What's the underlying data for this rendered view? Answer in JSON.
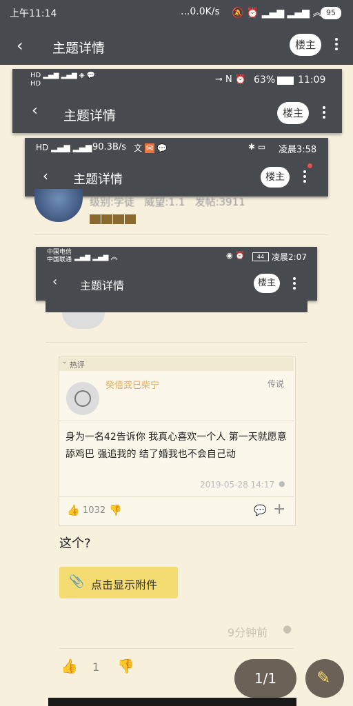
{
  "status_main": {
    "time": "上午11:14",
    "speed": "...0.0K/s",
    "battery": "95"
  },
  "header": {
    "title": "主题详情",
    "owner_label": "楼主"
  },
  "shot1": {
    "status_right": "63%",
    "time": "11:09",
    "title": "主题详情",
    "owner_label": "楼主"
  },
  "shot2": {
    "speed": "90.3B/s",
    "time": "凌晨3:58",
    "title": "主题详情",
    "owner_label": "楼主",
    "user_info": "级别:学徒   威望:1.1   发帖:3911"
  },
  "shot3": {
    "carrier1": "中国电信",
    "carrier2": "中国联通",
    "battery": "44",
    "time": "凌晨2:07",
    "title": "主题详情",
    "owner_label": "楼主"
  },
  "hot": {
    "section_label": "热评",
    "username": "癸僖龚巳柴宁",
    "rank": "传说",
    "content": "身为一名42告诉你 我真心喜欢一个人 第一天就愿意舔鸡巴 强追我的 结了婚我也不会自己动",
    "date": "2019-05-28 14:17",
    "likes": "1032"
  },
  "post": {
    "text": "这个?",
    "attach_label": "点击显示附件",
    "time_ago": "9分钟前",
    "likes": "1"
  },
  "pager": {
    "label": "1/1"
  },
  "colors": {
    "dark_bar": "#474b4f",
    "page_bg": "#f6f0dd",
    "attach_bg": "#f5dc72",
    "pager_bg": "#6b6157"
  }
}
